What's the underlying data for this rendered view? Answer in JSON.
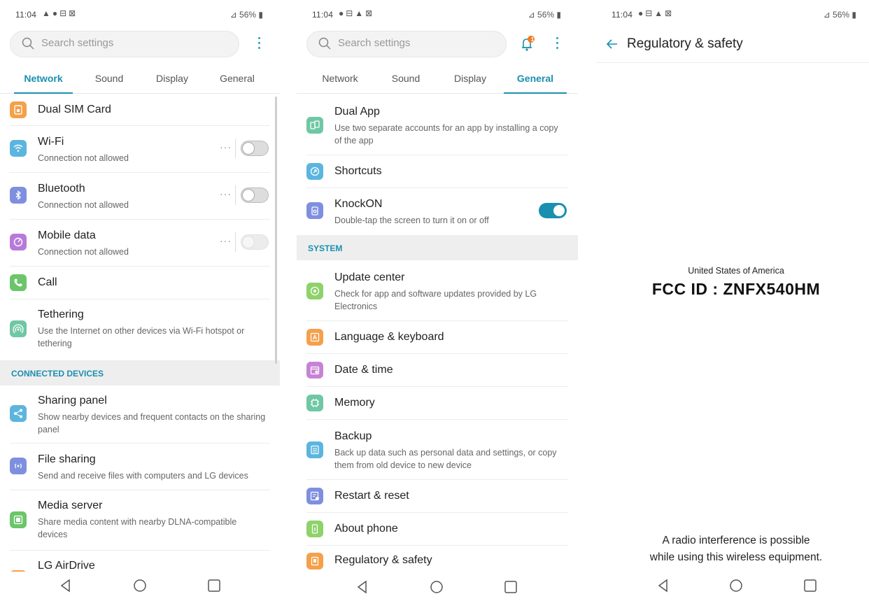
{
  "colors": {
    "accent": "#1a8fb0",
    "section_bg": "#eeeeee",
    "badge": "#f07a22"
  },
  "status": {
    "time": "11:04",
    "battery": "56%"
  },
  "search": {
    "placeholder": "Search settings"
  },
  "tabs": [
    "Network",
    "Sound",
    "Display",
    "General"
  ],
  "screen1": {
    "active_tab": "Network",
    "items": [
      {
        "title": "Dual SIM Card",
        "icon": "sim-icon"
      },
      {
        "title": "Wi-Fi",
        "subtitle": "Connection not allowed",
        "icon": "wifi-icon",
        "toggle": "off"
      },
      {
        "title": "Bluetooth",
        "subtitle": "Connection not allowed",
        "icon": "bluetooth-icon",
        "toggle": "off"
      },
      {
        "title": "Mobile data",
        "subtitle": "Connection not allowed",
        "icon": "mobile-data-icon",
        "toggle": "disabled"
      },
      {
        "title": "Call",
        "icon": "phone-icon"
      },
      {
        "title": "Tethering",
        "subtitle": "Use the Internet on other devices via Wi-Fi hotspot or tethering",
        "icon": "tethering-icon"
      }
    ],
    "section": "CONNECTED DEVICES",
    "items2": [
      {
        "title": "Sharing panel",
        "subtitle": "Show nearby devices and frequent contacts on the sharing panel",
        "icon": "share-icon"
      },
      {
        "title": "File sharing",
        "subtitle": "Send and receive files with computers and LG devices",
        "icon": "file-sharing-icon"
      },
      {
        "title": "Media server",
        "subtitle": "Share media content with nearby DLNA-compatible devices",
        "icon": "media-server-icon"
      },
      {
        "title": "LG AirDrive",
        "icon": "airdrive-icon"
      }
    ]
  },
  "screen2": {
    "active_tab": "General",
    "notification_count": "1",
    "items": [
      {
        "title": "Dual App",
        "subtitle": "Use two separate accounts for an app by installing a copy of the app",
        "icon": "dual-app-icon"
      },
      {
        "title": "Shortcuts",
        "icon": "shortcuts-icon"
      },
      {
        "title": "KnockON",
        "subtitle": "Double-tap the screen to turn it on or off",
        "icon": "knockon-icon",
        "toggle": "on"
      }
    ],
    "section": "SYSTEM",
    "items2": [
      {
        "title": "Update center",
        "subtitle": "Check for app and software updates provided by LG Electronics",
        "icon": "update-center-icon"
      },
      {
        "title": "Language & keyboard",
        "icon": "language-icon"
      },
      {
        "title": "Date & time",
        "icon": "calendar-icon"
      },
      {
        "title": "Memory",
        "icon": "memory-icon"
      },
      {
        "title": "Backup",
        "subtitle": "Back up data such as personal data and settings, or copy them from old device to new device",
        "icon": "backup-icon"
      },
      {
        "title": "Restart & reset",
        "icon": "reset-icon"
      },
      {
        "title": "About phone",
        "icon": "phone-info-icon"
      },
      {
        "title": "Regulatory & safety",
        "icon": "regulatory-icon"
      }
    ]
  },
  "screen3": {
    "title": "Regulatory & safety",
    "country": "United States of America",
    "fcc_id": "FCC ID : ZNFX540HM",
    "note_line1": "A radio interference is possible",
    "note_line2": "while using this wireless equipment."
  }
}
